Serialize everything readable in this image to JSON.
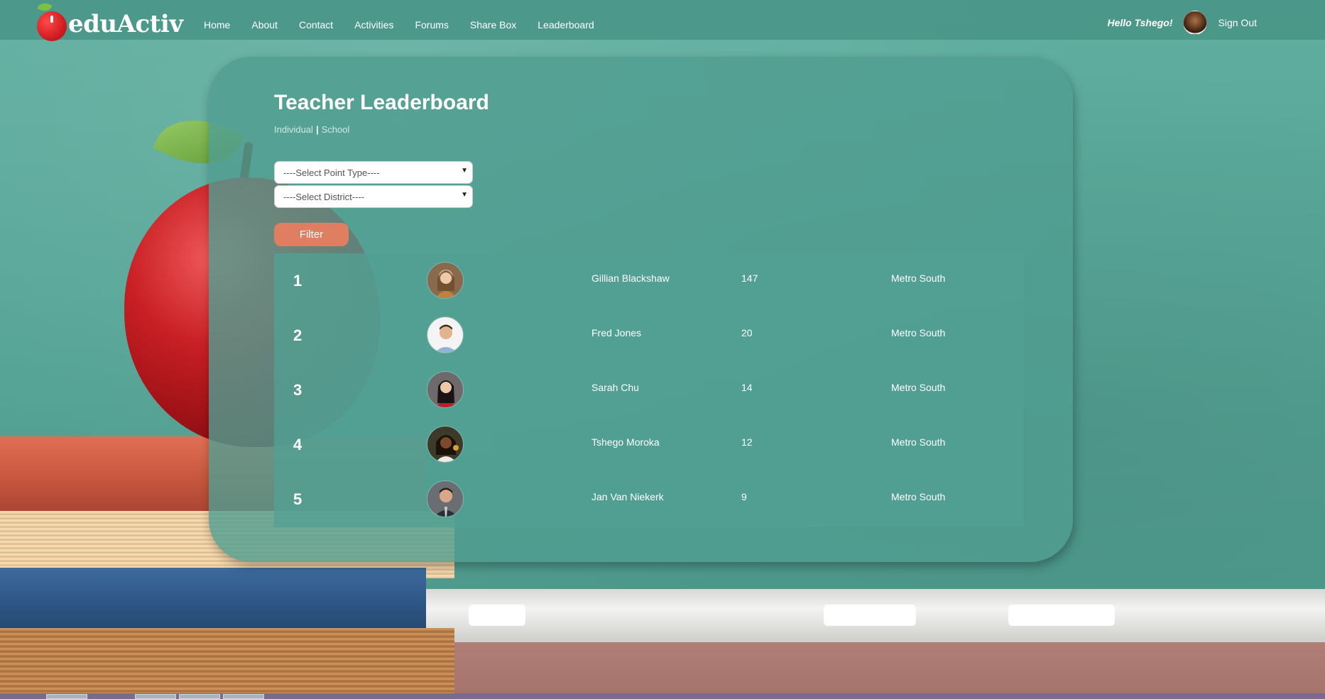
{
  "brand": {
    "name": "eduActiv"
  },
  "nav": {
    "links": [
      "Home",
      "About",
      "Contact",
      "Activities",
      "Forums",
      "Share Box",
      "Leaderboard"
    ],
    "greeting": "Hello Tshego!",
    "signout": "Sign Out"
  },
  "page": {
    "title": "Teacher Leaderboard",
    "tabs": {
      "individual": "Individual",
      "separator": "|",
      "school": "School"
    },
    "filters": {
      "point_type": "----Select Point Type----",
      "district": "----Select District----",
      "button": "Filter"
    }
  },
  "leaderboard": [
    {
      "rank": "1",
      "name": "Gillian Blackshaw",
      "points": "147",
      "district": "Metro South"
    },
    {
      "rank": "2",
      "name": "Fred Jones",
      "points": "20",
      "district": "Metro South"
    },
    {
      "rank": "3",
      "name": "Sarah Chu",
      "points": "14",
      "district": "Metro South"
    },
    {
      "rank": "4",
      "name": "Tshego Moroka",
      "points": "12",
      "district": "Metro South"
    },
    {
      "rank": "5",
      "name": "Jan Van Niekerk",
      "points": "9",
      "district": "Metro South"
    }
  ],
  "colors": {
    "navbar": "#4a9688",
    "panel": "#509e91",
    "filter_button": "#e07e62"
  }
}
